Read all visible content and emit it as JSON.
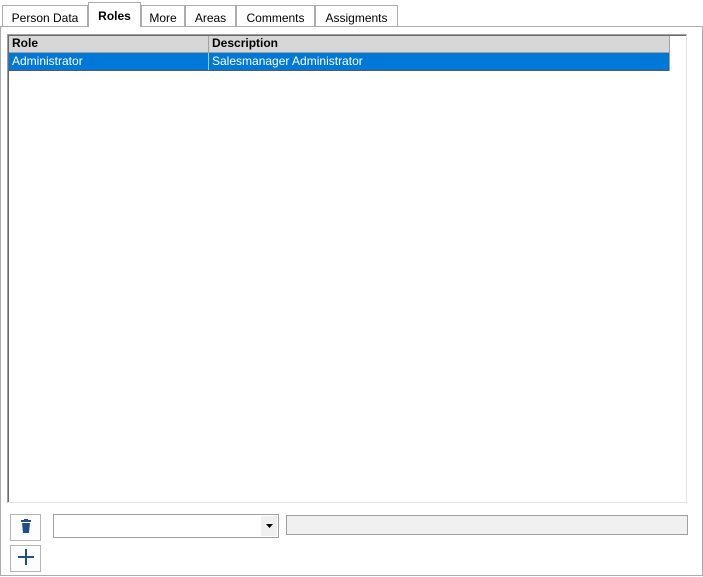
{
  "tabs": [
    {
      "label": "Person Data",
      "active": false
    },
    {
      "label": "Roles",
      "active": true
    },
    {
      "label": "More",
      "active": false
    },
    {
      "label": "Areas",
      "active": false
    },
    {
      "label": "Comments",
      "active": false
    },
    {
      "label": "Assigments",
      "active": false
    }
  ],
  "grid": {
    "columns": [
      "Role",
      "Description"
    ],
    "rows": [
      {
        "role": "Administrator",
        "description": "Salesmanager Administrator",
        "selected": true
      }
    ]
  },
  "controls": {
    "delete_icon": "trash-icon",
    "add_icon": "plus-icon",
    "role_combo_value": "",
    "description_value": ""
  },
  "colors": {
    "selection": "#0078d7",
    "header_bg": "#d7d7d7",
    "icon": "#1f4e8c"
  }
}
